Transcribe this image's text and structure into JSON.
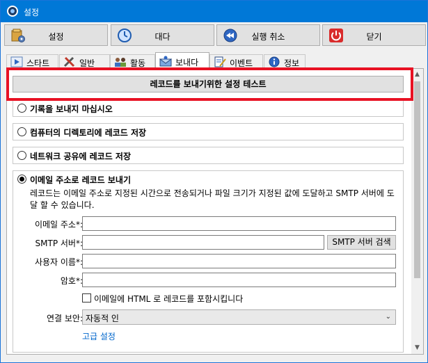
{
  "window": {
    "title": "설정"
  },
  "toolbar": {
    "settings": "설정",
    "wait": "대다",
    "undo": "실행 취소",
    "close": "닫기"
  },
  "tabs": [
    "스타트",
    "일반",
    "활동",
    "보내다",
    "이벤트",
    "정보"
  ],
  "active_tab": "보내다",
  "send": {
    "test_button": "레코드를 보내기위한 설정 테스트",
    "options": [
      {
        "label": "기록을 보내지 마십시오",
        "checked": false
      },
      {
        "label": "컴퓨터의 디렉토리에 레코드 저장",
        "checked": false
      },
      {
        "label": "네트워크 공유에 레코드 저장",
        "checked": false
      },
      {
        "label": "이메일 주소로 레코드 보내기",
        "checked": true
      }
    ],
    "email": {
      "description": "레코드는 이메일 주소로 지정된 시간으로 전송되거나 파일 크기가 지정된 값에 도달하고 SMTP 서버에 도달 할 수 있습니다.",
      "address_label": "이메일 주소*:",
      "address_value": "",
      "smtp_label": "SMTP 서버*:",
      "smtp_value": "",
      "smtp_search": "SMTP 서버 검색",
      "username_label": "사용자 이름*:",
      "username_value": "",
      "password_label": "암호*:",
      "password_value": "",
      "html_checkbox_label": "이메일에 HTML 로 레코드를 포함시킵니다",
      "html_checked": false,
      "security_label": "연결 보안:",
      "security_value": "자동적 인",
      "advanced_link": "고급 설정"
    }
  },
  "colors": {
    "titlebar": "#0078d7",
    "highlight": "#e81123",
    "link": "#0066cc"
  }
}
